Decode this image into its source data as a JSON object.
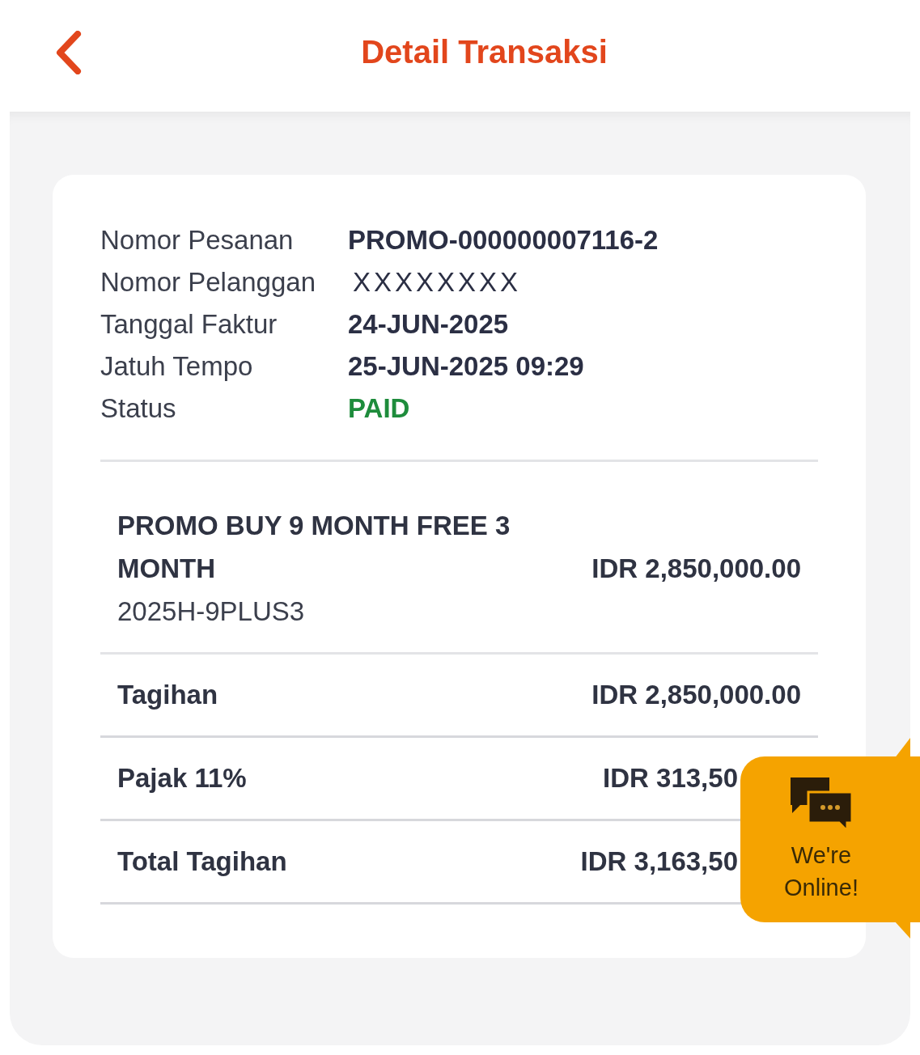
{
  "header": {
    "title": "Detail Transaksi"
  },
  "info": [
    {
      "label": "Nomor Pesanan",
      "value": "PROMO-000000007116-2",
      "kind": "text"
    },
    {
      "label": "Nomor Pelanggan",
      "value": "XXXXXXXX",
      "kind": "masked"
    },
    {
      "label": "Tanggal Faktur",
      "value": "24-JUN-2025",
      "kind": "text"
    },
    {
      "label": "Jatuh Tempo",
      "value": "25-JUN-2025 09:29",
      "kind": "text"
    },
    {
      "label": "Status",
      "value": "PAID",
      "kind": "status"
    }
  ],
  "item": {
    "name": "PROMO BUY 9 MONTH FREE 3 MONTH",
    "code": "2025H-9PLUS3",
    "amount": "IDR 2,850,000.00"
  },
  "summary": [
    {
      "label": "Tagihan",
      "amount": "IDR 2,850,000.00",
      "covered": false
    },
    {
      "label": "Pajak 11%",
      "amount": "IDR 313,50",
      "covered": true
    },
    {
      "label": "Total Tagihan",
      "amount": "IDR 3,163,50",
      "covered": true
    }
  ],
  "chat_widget": {
    "label": "We're Online!"
  }
}
